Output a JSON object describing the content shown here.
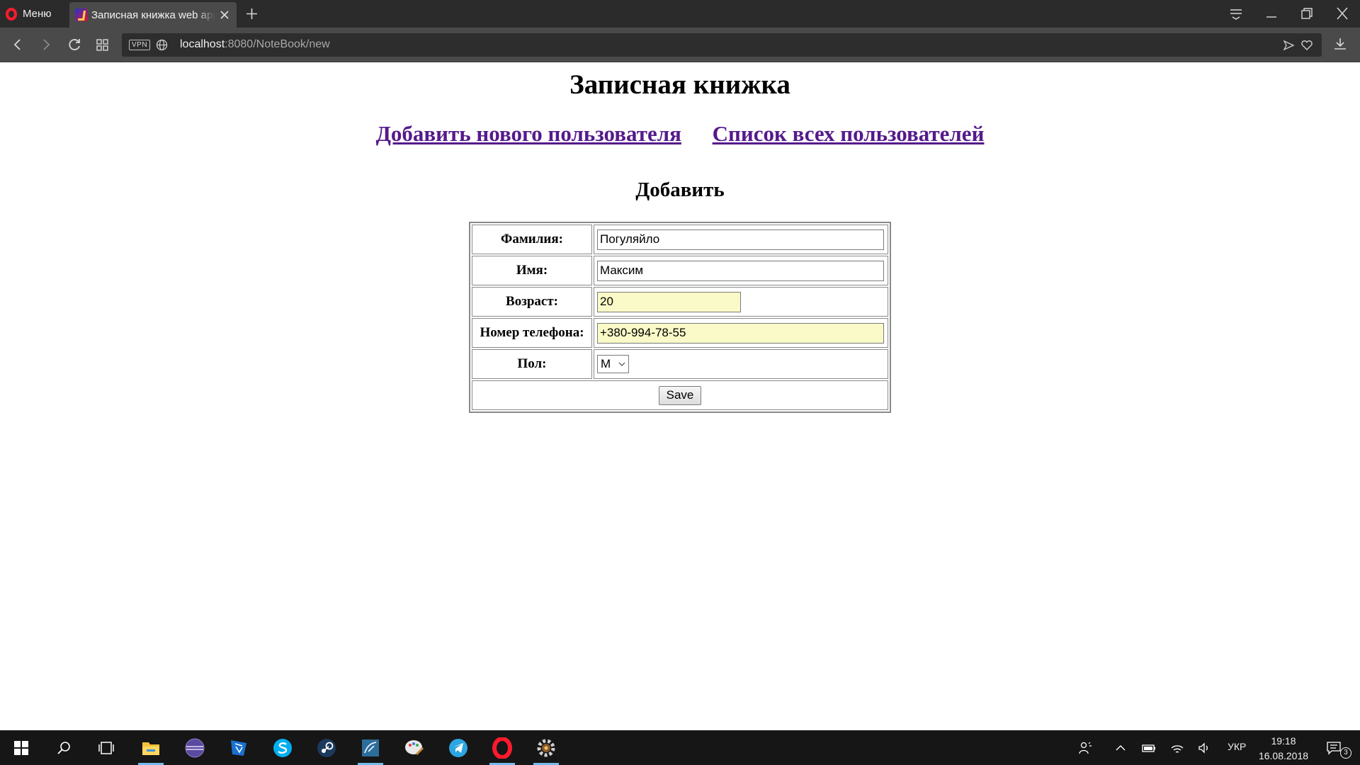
{
  "browser": {
    "menu_label": "Меню",
    "tab_title": "Записная книжка web app",
    "url_host": "localhost",
    "url_rest": ":8080/NoteBook/new",
    "vpn_label": "VPN"
  },
  "page": {
    "title": "Записная книжка",
    "links": {
      "add_user": "Добавить нового пользователя",
      "all_users": "Список всех пользователей"
    },
    "form_heading": "Добавить",
    "fields": {
      "lastname_label": "Фамилия:",
      "lastname_value": "Погуляйло",
      "firstname_label": "Имя:",
      "firstname_value": "Максим",
      "age_label": "Возраст:",
      "age_value": "20",
      "phone_label": "Номер телефона:",
      "phone_value": "+380-994-78-55",
      "gender_label": "Пол:",
      "gender_value": "M"
    },
    "save_label": "Save",
    "colors": {
      "link": "#551a8b",
      "autofill": "#fafac8"
    }
  },
  "taskbar": {
    "apps": [
      "start-icon",
      "search-icon",
      "task-view-icon",
      "file-explorer-icon",
      "eclipse-icon",
      "intellij-icon",
      "skype-icon",
      "steam-icon",
      "mysql-workbench-icon",
      "paint-icon",
      "telegram-icon",
      "opera-icon",
      "settings-app-icon"
    ],
    "language": "УКР",
    "time": "19:18",
    "date": "16.08.2018",
    "notification_count": "3"
  }
}
